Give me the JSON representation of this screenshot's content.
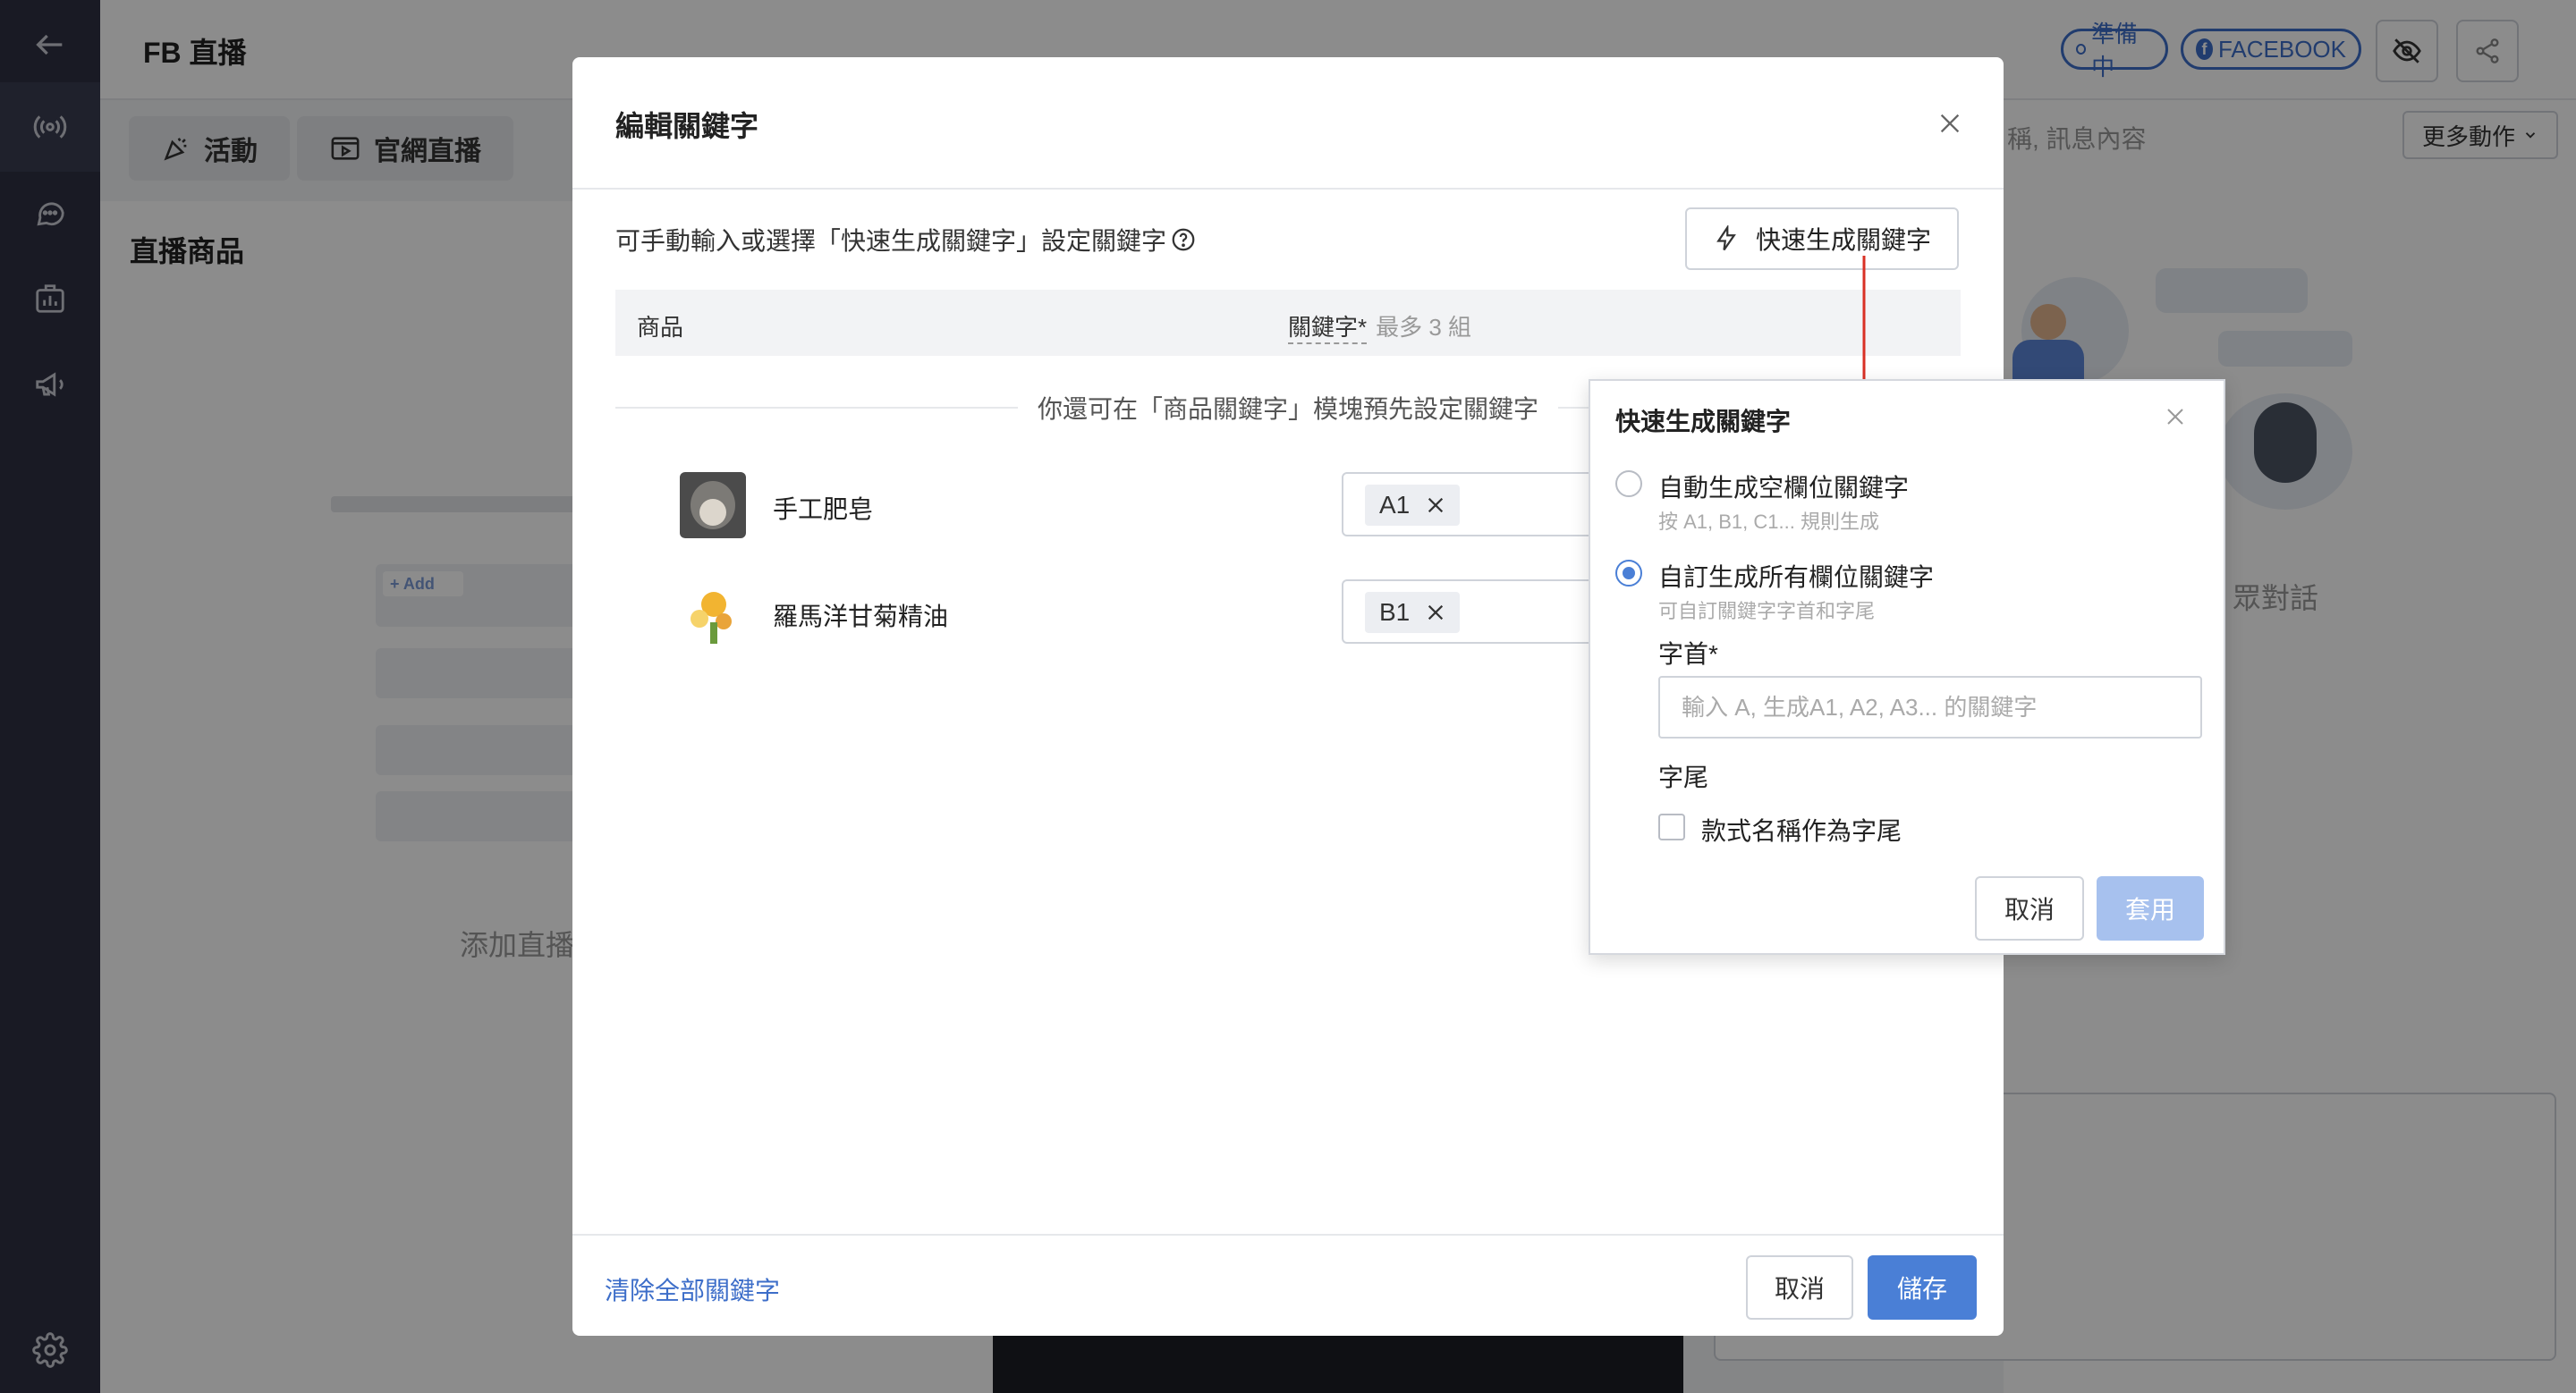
{
  "page": {
    "title": "FB 直播",
    "status_pill": "準備中",
    "platform_pill": "FACEBOOK",
    "tabs": [
      {
        "label": "活動",
        "icon": "confetti-icon"
      },
      {
        "label": "官網直播",
        "icon": "browser-video-icon"
      }
    ],
    "section_title": "直播商品",
    "search_fragment": "稱, 訊息內容",
    "more_actions": "更多動作",
    "chat_fragment": "眾對話",
    "add_fragment": "添加直播"
  },
  "sidebar": {
    "items": [
      {
        "icon": "back-arrow-icon"
      },
      {
        "icon": "live-broadcast-icon"
      },
      {
        "icon": "chat-bubble-icon"
      },
      {
        "icon": "analytics-icon"
      },
      {
        "icon": "megaphone-icon"
      },
      {
        "icon": "settings-gear-icon"
      }
    ]
  },
  "modal": {
    "title": "編輯關鍵字",
    "hint": "可手動輸入或選擇「快速生成關鍵字」設定關鍵字",
    "quick_button": "快速生成關鍵字",
    "table": {
      "col_product": "商品",
      "col_keyword": "關鍵字*",
      "col_keyword_max": "最多 3 組"
    },
    "divider_note": "你還可在「商品關鍵字」模塊預先設定關鍵字",
    "products": [
      {
        "name": "手工肥皂",
        "keyword": "A1"
      },
      {
        "name": "羅馬洋甘菊精油",
        "keyword": "B1"
      }
    ],
    "footer": {
      "clear_all": "清除全部關鍵字",
      "cancel": "取消",
      "save": "儲存"
    }
  },
  "popover": {
    "title": "快速生成關鍵字",
    "options": [
      {
        "label": "自動生成空欄位關鍵字",
        "sub": "按 A1, B1, C1... 規則生成",
        "selected": false
      },
      {
        "label": "自訂生成所有欄位關鍵字",
        "sub": "可自訂關鍵字字首和字尾",
        "selected": true
      }
    ],
    "prefix_label": "字首*",
    "prefix_placeholder": "輸入 A, 生成A1, A2, A3... 的關鍵字",
    "prefix_value": "",
    "suffix_label": "字尾",
    "suffix_checkbox_label": "款式名稱作為字尾",
    "suffix_checked": false,
    "cancel": "取消",
    "apply": "套用"
  },
  "colors": {
    "accent": "#4a7fd6",
    "accent_disabled": "#a7c1ee",
    "sidebar": "#2f3142",
    "annotation_arrow": "#d93025"
  }
}
